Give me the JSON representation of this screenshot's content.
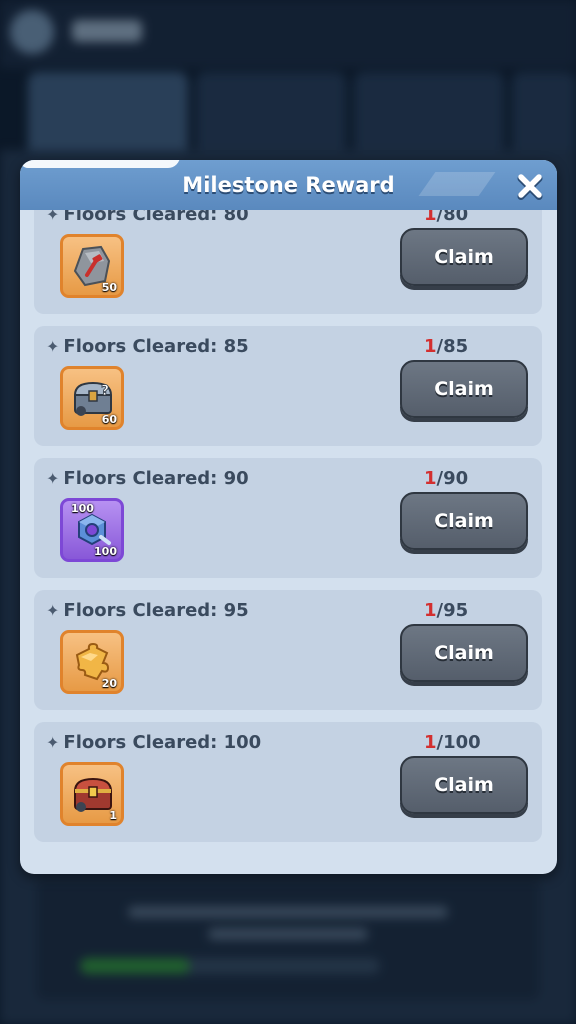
{
  "modal": {
    "title": "Milestone Reward",
    "close_icon": "close-icon"
  },
  "milestones": [
    {
      "label": "Floors Cleared: 80",
      "progress_current": "1",
      "progress_total": "/80",
      "reward_icon": "enhance-stone-icon",
      "reward_qty": "50",
      "reward_qty_top": "",
      "claim_label": "Claim"
    },
    {
      "label": "Floors Cleared: 85",
      "progress_current": "1",
      "progress_total": "/85",
      "reward_icon": "mystery-chest-icon",
      "reward_qty": "60",
      "reward_qty_top": "",
      "claim_label": "Claim"
    },
    {
      "label": "Floors Cleared: 90",
      "progress_current": "1",
      "progress_total": "/90",
      "reward_icon": "hex-nut-icon",
      "reward_qty": "100",
      "reward_qty_top": "100",
      "claim_label": "Claim"
    },
    {
      "label": "Floors Cleared: 95",
      "progress_current": "1",
      "progress_total": "/95",
      "reward_icon": "puzzle-piece-icon",
      "reward_qty": "20",
      "reward_qty_top": "",
      "claim_label": "Claim"
    },
    {
      "label": "Floors Cleared: 100",
      "progress_current": "1",
      "progress_total": "/100",
      "reward_icon": "treasure-chest-icon",
      "reward_qty": "1",
      "reward_qty_top": "",
      "claim_label": "Claim"
    }
  ],
  "colors": {
    "header": "#5a89be",
    "panel": "#d3e0ee",
    "row": "#c4d2e3",
    "progress_current": "#d32f2f",
    "claim_button": "#5f6875",
    "orange_frame": "#e0832c",
    "purple_frame": "#7d48d6"
  }
}
